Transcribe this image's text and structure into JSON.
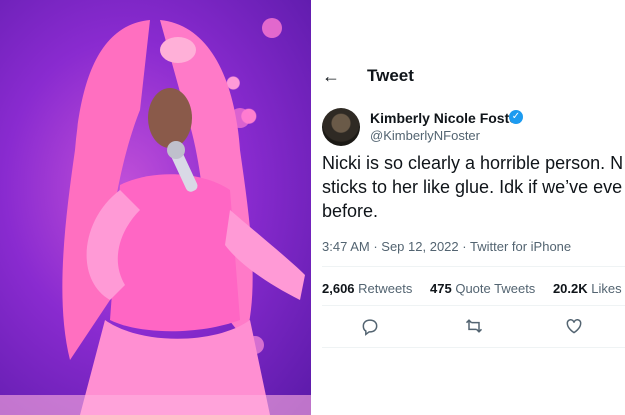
{
  "tweet_header": {
    "title": "Tweet"
  },
  "author": {
    "name": "Kimberly Nicole Foster",
    "handle": "@KimberlyNFoster",
    "verified": true
  },
  "tweet": {
    "lines": [
      "Nicki is so clearly a horrible person. N",
      "sticks to her like glue. Idk if we’ve eve",
      "before."
    ],
    "time": "3:47 AM",
    "date": "Sep 12, 2022",
    "source": "Twitter for iPhone"
  },
  "stats": {
    "retweets_count": "2,606",
    "retweets_label": "Retweets",
    "quotes_count": "475",
    "quotes_label": "Quote Tweets",
    "likes_count": "20.2K",
    "likes_label": "Likes"
  },
  "colors": {
    "verified": "#1d9bf0",
    "muted": "#536471",
    "text": "#0f1419"
  },
  "icons": [
    "back-arrow-icon",
    "verified-badge-icon",
    "reply-icon",
    "retweet-icon",
    "like-icon"
  ]
}
